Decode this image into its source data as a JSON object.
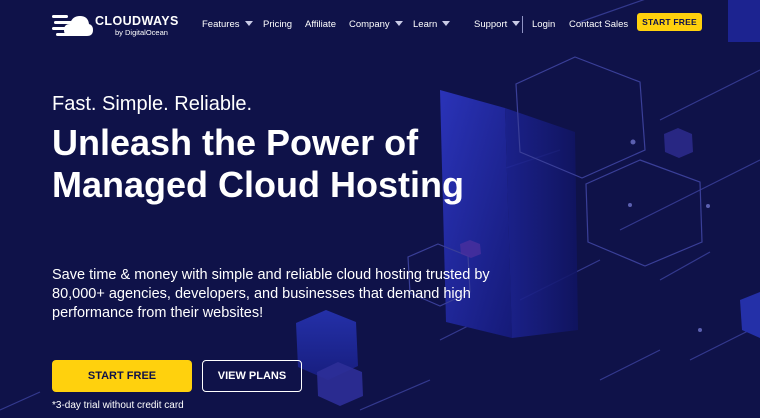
{
  "brand": {
    "name": "CLOUDWAYS",
    "sub": "by DigitalOcean"
  },
  "nav": {
    "features": "Features",
    "pricing": "Pricing",
    "affiliate": "Affiliate",
    "company": "Company",
    "learn": "Learn",
    "support": "Support",
    "login": "Login",
    "contact": "Contact Sales",
    "start_free": "START FREE"
  },
  "hero": {
    "tagline": "Fast. Simple. Reliable.",
    "headline": "Unleash the Power of Managed Cloud Hosting",
    "description": "Save time & money with simple and reliable cloud hosting trusted by 80,000+ agencies, developers, and businesses that demand high performance from their websites!",
    "primary_cta": "START FREE",
    "secondary_cta": "VIEW PLANS",
    "note": "*3-day trial without credit card"
  },
  "colors": {
    "background": "#0f1249",
    "accent": "#ffd10d",
    "text": "#ffffff"
  }
}
